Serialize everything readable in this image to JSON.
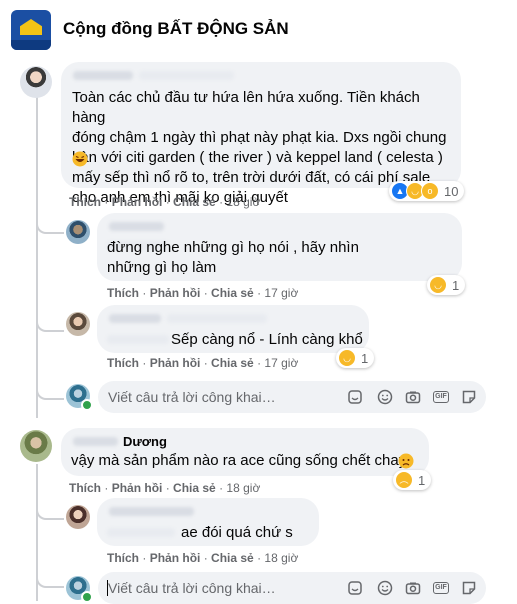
{
  "header": {
    "group_name": "Cộng đồng BẤT ĐỘNG SẢN"
  },
  "actions": {
    "like": "Thích",
    "reply": "Phản hồi",
    "share": "Chia sẻ",
    "separator": "·"
  },
  "comments": [
    {
      "text": "Toàn các chủ đầu tư hứa lên hứa xuống. Tiền khách hàng\nđóng chậm 1 ngày thì phạt này phạt kia. Dxs ngồi chung\nbàn với citi garden ( the river ) và keppel land ( celesta )\n     mấy sếp thì nổ rõ to, trên trời dưới đất, có cái phí sale\ncho anh em thì mãi ko giải quyết",
      "time": "18 giờ",
      "reaction_count": "10",
      "reactions": [
        "like-reaction",
        "haha-reaction",
        "wow-reaction"
      ]
    },
    {
      "text": "            đừng nghe những gì họ nói , hãy nhìn\nnhững gì họ làm",
      "time": "17 giờ",
      "reaction_count": "1",
      "reactions": [
        "haha-reaction"
      ]
    },
    {
      "text": "Sếp càng nổ - Lính càng khổ",
      "time": "17 giờ",
      "reaction_count": "1",
      "reactions": [
        "haha-reaction"
      ]
    },
    {
      "author_partial": "Dương",
      "text": "vậy mà sản phẩm nào ra ace cũng sống chết chay",
      "time": "18 giờ",
      "reaction_count": "1",
      "reactions": [
        "sad-reaction"
      ]
    },
    {
      "text": "ae đói quá chứ s",
      "time": "18 giờ"
    }
  ],
  "reply_box": {
    "placeholder": "Viết câu trả lời công khai…"
  },
  "tool_icons": [
    "sticker-icon",
    "emoji-icon",
    "camera-icon",
    "gif-icon",
    "image-sticker-icon"
  ],
  "colors": {
    "bubble": "#f0f2f5",
    "meta_text": "#65676b",
    "like_blue": "#1877f2",
    "reaction_yellow": "#f7b928",
    "online_green": "#31a24c"
  }
}
